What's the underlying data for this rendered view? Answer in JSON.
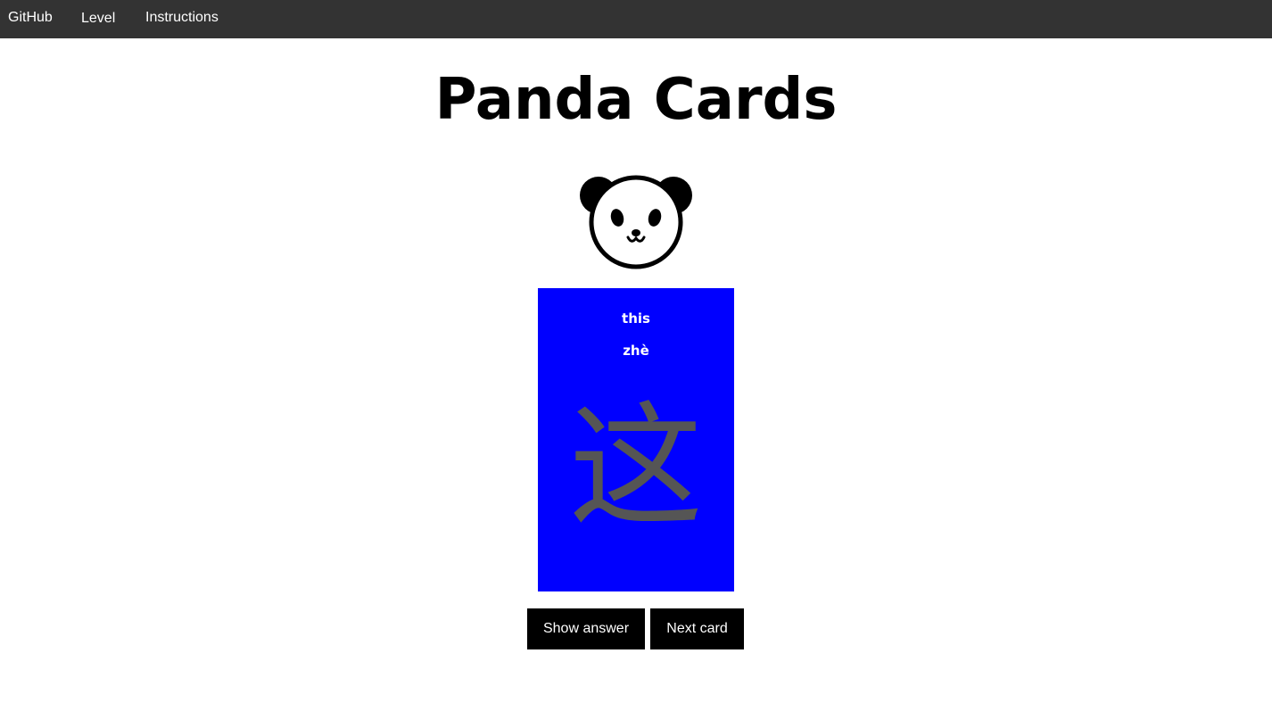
{
  "nav": {
    "items": [
      {
        "label": "GitHub"
      },
      {
        "label": "Level"
      },
      {
        "label": "Instructions"
      }
    ]
  },
  "header": {
    "title": "Panda Cards"
  },
  "logo": {
    "icon": "panda-face-icon"
  },
  "card": {
    "english": "this",
    "pinyin": "zhè",
    "character": "这",
    "background_color": "#0000ff",
    "character_color": "#555555"
  },
  "actions": {
    "show_answer_label": "Show answer",
    "next_card_label": "Next card"
  },
  "colors": {
    "navbar": "#333333",
    "button": "#000000"
  }
}
